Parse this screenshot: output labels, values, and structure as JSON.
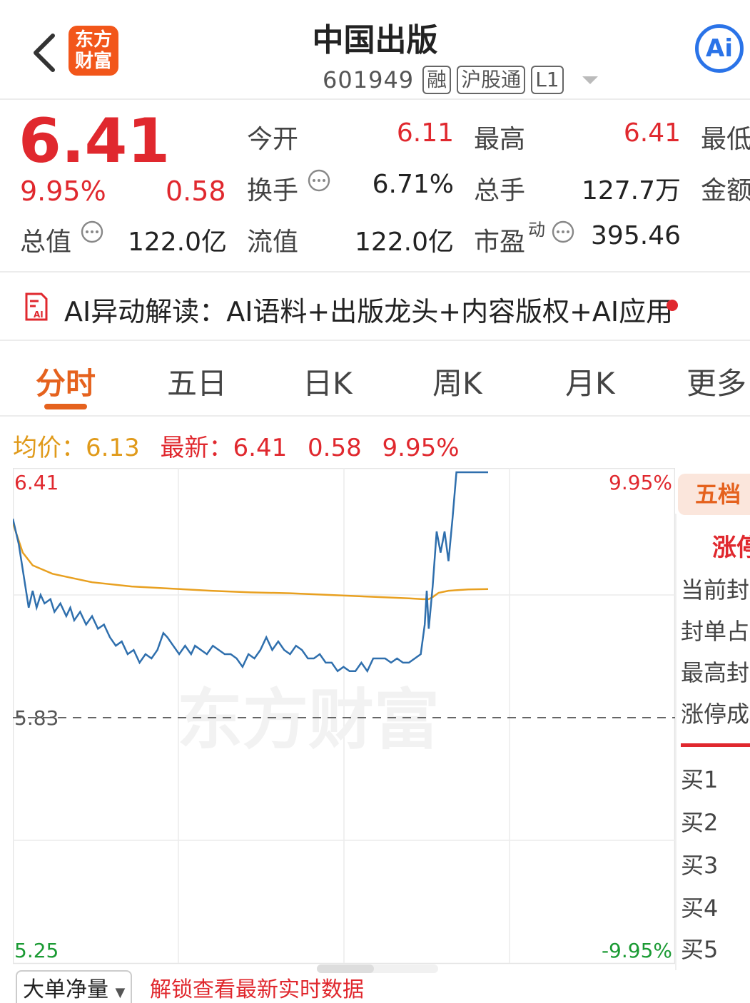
{
  "header": {
    "title": "中国出版",
    "code": "601949",
    "tags": [
      "融",
      "沪股通",
      "L1"
    ],
    "logo_text": [
      "东方",
      "财富"
    ],
    "ai_button": "Ai"
  },
  "quote": {
    "price": "6.41",
    "change_pct": "9.95%",
    "change": "0.58",
    "labels": {
      "open": "今开",
      "high": "最高",
      "low": "最低",
      "turnover": "换手",
      "volume": "总手",
      "amount": "金额",
      "market_cap": "总值",
      "float_cap": "流值",
      "pe": "市盈",
      "pe_sup": "动"
    },
    "values": {
      "open": "6.11",
      "high": "6.41",
      "turnover": "6.71%",
      "volume": "127.7万",
      "market_cap": "122.0亿",
      "float_cap": "122.0亿",
      "pe": "395.46"
    }
  },
  "ai_strip": {
    "text": "AI异动解读：AI语料+出版龙头+内容版权+AI应用"
  },
  "tabs": [
    "分时",
    "五日",
    "日K",
    "周K",
    "月K",
    "更多"
  ],
  "chart_header": {
    "avg_label": "均价：",
    "avg_value": "6.13",
    "latest_label": "最新：",
    "latest_value": "6.41",
    "change": "0.58",
    "change_pct": "9.95%"
  },
  "chart_data": {
    "type": "line",
    "watermark": "东方财富",
    "y_labels_left": [
      "6.41",
      "5.83",
      "5.25"
    ],
    "y_labels_right": [
      "9.95%",
      "-9.95%"
    ],
    "ylim": [
      5.25,
      6.41
    ],
    "prev_close": 5.83,
    "x_range": [
      0,
      240
    ],
    "series": [
      {
        "name": "price",
        "color": "#2f6fad",
        "x": [
          0,
          3,
          8,
          10,
          12,
          14,
          16,
          19,
          21,
          24,
          27,
          29,
          31,
          34,
          37,
          40,
          43,
          46,
          49,
          52,
          55,
          58,
          61,
          64,
          67,
          70,
          73,
          76,
          78,
          81,
          84,
          87,
          90,
          92,
          95,
          98,
          101,
          104,
          107,
          110,
          113,
          116,
          119,
          122,
          125,
          128,
          131,
          134,
          137,
          140,
          143,
          146,
          149,
          152,
          155,
          158,
          161,
          164,
          167,
          170,
          173,
          176,
          179,
          182,
          185,
          188,
          191,
          194,
          197,
          200,
          203,
          206,
          208,
          209,
          210,
          212,
          214,
          216,
          218,
          220,
          222,
          224,
          230,
          240
        ],
        "y": [
          6.3,
          6.24,
          6.09,
          6.13,
          6.09,
          6.12,
          6.1,
          6.11,
          6.08,
          6.1,
          6.07,
          6.09,
          6.06,
          6.08,
          6.05,
          6.07,
          6.04,
          6.05,
          6.02,
          6.0,
          6.01,
          5.98,
          5.99,
          5.96,
          5.98,
          5.97,
          5.99,
          6.03,
          6.02,
          6.0,
          5.98,
          6.0,
          5.98,
          6.0,
          5.99,
          5.98,
          6.0,
          5.99,
          5.98,
          5.98,
          5.97,
          5.95,
          5.98,
          5.97,
          5.99,
          6.02,
          5.99,
          6.01,
          5.99,
          5.98,
          6.0,
          5.99,
          5.97,
          5.97,
          5.98,
          5.96,
          5.96,
          5.94,
          5.95,
          5.94,
          5.94,
          5.96,
          5.94,
          5.97,
          5.97,
          5.97,
          5.96,
          5.97,
          5.96,
          5.96,
          5.97,
          5.98,
          6.05,
          6.13,
          6.04,
          6.14,
          6.27,
          6.22,
          6.27,
          6.2,
          6.3,
          6.41,
          6.41,
          6.41
        ]
      },
      {
        "name": "avg",
        "color": "#e8a020",
        "x": [
          0,
          5,
          10,
          15,
          20,
          30,
          40,
          60,
          80,
          100,
          120,
          140,
          160,
          180,
          200,
          207,
          210,
          212,
          215,
          220,
          230,
          240
        ],
        "y": [
          6.29,
          6.22,
          6.19,
          6.18,
          6.17,
          6.16,
          6.15,
          6.14,
          6.135,
          6.13,
          6.126,
          6.124,
          6.12,
          6.116,
          6.112,
          6.11,
          6.11,
          6.115,
          6.125,
          6.13,
          6.133,
          6.134
        ]
      }
    ]
  },
  "side_panel": {
    "tab": "五档",
    "limit_up": "涨停",
    "rows": [
      "当前封",
      "封单占",
      "最高封",
      "涨停成"
    ],
    "bids": [
      "买1",
      "买2",
      "买3",
      "买4",
      "买5"
    ]
  },
  "bottom": {
    "big_net": "大单净量",
    "unlock": "解锁查看最新实时数据"
  },
  "colors": {
    "up": "#e0282e",
    "down": "#1a9a33",
    "accent": "#e5621e",
    "ai_blue": "#2a73e8"
  }
}
